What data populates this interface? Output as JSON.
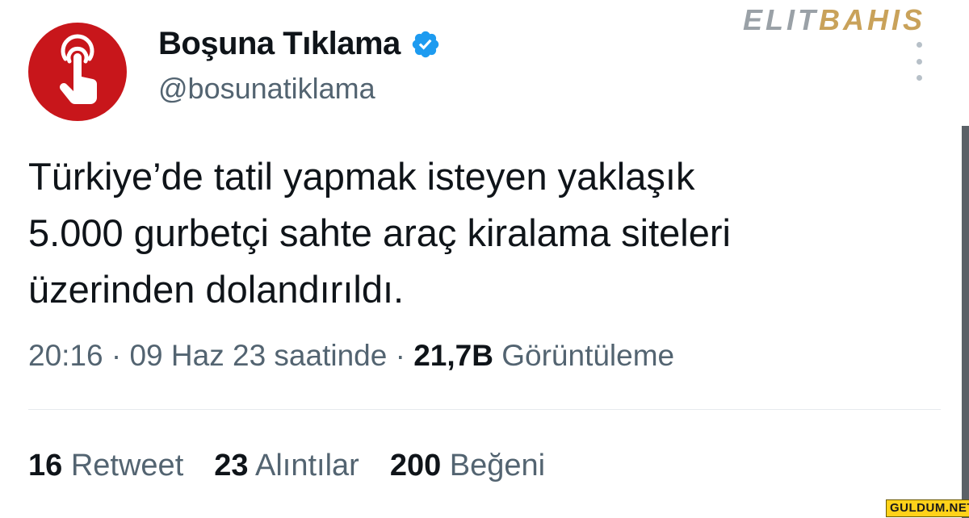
{
  "author": {
    "display_name": "Boşuna Tıklama",
    "handle": "@bosunatiklama",
    "verified": true,
    "avatar_icon": "tap-hand-icon",
    "avatar_color": "#c8161b"
  },
  "tweet": {
    "text": "Türkiye’de tatil yapmak isteyen yaklaşık\n5.000 gurbetçi sahte araç kiralama siteleri\nüzerinden dolandırıldı."
  },
  "meta": {
    "time": "20:16",
    "separator": "·",
    "date": "09 Haz 23 saatinde",
    "views_count": "21,7B",
    "views_label": "Görüntüleme"
  },
  "stats": {
    "retweets_count": "16",
    "retweets_label": "Retweet",
    "quotes_count": "23",
    "quotes_label": "Alıntılar",
    "likes_count": "200",
    "likes_label": "Beğeni"
  },
  "watermarks": {
    "top_part1": "ELIT",
    "top_part2": "BAHIS",
    "bottom": "GULDUM.NET"
  },
  "colors": {
    "verified_blue": "#1d9bf0",
    "secondary_text": "#536471",
    "primary_text": "#0f1419"
  }
}
